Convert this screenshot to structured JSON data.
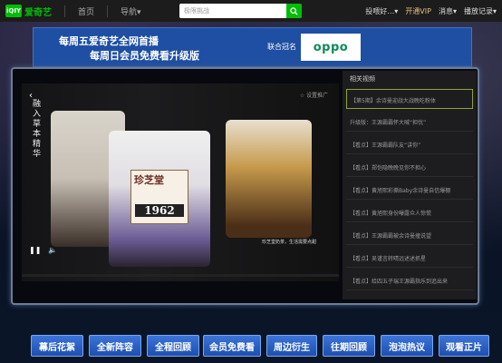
{
  "header": {
    "logo_mark": "iQIY",
    "logo_text": "爱奇艺",
    "nav_home": "首页",
    "nav_nav": "导航▾",
    "search_placeholder": "极限挑战",
    "user": "投喂好…▾",
    "vip": "开通VIP",
    "msg": "消息▾",
    "history": "播放记录▾"
  },
  "banner": {
    "line1": "每周五爱奇艺全网首播",
    "line2": "每周日会员免费看升级版",
    "sponsor_label": "联合冠名",
    "sponsor_brand": "oppo"
  },
  "video": {
    "vertical_text": "融入草本精华",
    "brand": "珍芝堂",
    "year": "1962",
    "corner_text": "☆ 设置推广",
    "subtitle": "珍芝堂奶茶，生活需要点甜"
  },
  "sidebar": {
    "title": "相关视频",
    "items": [
      {
        "label": "【第5期】余诗曼迎战大战晚吃粉体"
      },
      {
        "label": "升级版：王源霸霸怀大喊“担忧”"
      },
      {
        "label": "【看点】王源霸霸队友“讲你”"
      },
      {
        "label": "【看点】郑恺隐晚晚见你不担心"
      },
      {
        "label": "【看点】黄旭熙彩撕Baby余诗曼自信爆棚"
      },
      {
        "label": "【看点】黄旭熙身份曝露众人惊慌"
      },
      {
        "label": "【看点】王源霸霸被余诗曼撞说望"
      },
      {
        "label": "【看点】吴谨言转晴远述述抓星"
      },
      {
        "label": "【看点】给四五子瑞王源霸指乐到追出来"
      }
    ]
  },
  "progress": {
    "fraction": 0.0
  },
  "bottom_buttons": [
    "幕后花絮",
    "全新阵容",
    "全程回顾",
    "会员免费看",
    "周边衍生",
    "往期回顾",
    "泡泡热议",
    "观看正片"
  ],
  "colors": {
    "accent": "#00be06",
    "banner": "#1e4fa3"
  }
}
